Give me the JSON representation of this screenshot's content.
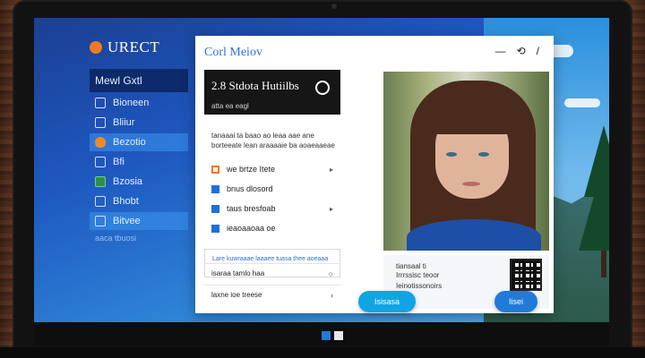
{
  "brand": {
    "name": "URECT",
    "logo_color": "#f07a22"
  },
  "sidebar": {
    "header": "Mewl Gxtl",
    "items": [
      {
        "label": "Bioneen",
        "icon": "globe-icon",
        "active": false
      },
      {
        "label": "Bliiur",
        "icon": "grid-icon",
        "active": false
      },
      {
        "label": "Bezotio",
        "icon": "shield-icon",
        "active": true
      },
      {
        "label": "Bfi",
        "icon": "folder-icon",
        "active": false
      },
      {
        "label": "Bzosia",
        "icon": "green-app-icon",
        "active": false
      },
      {
        "label": "Bhobt",
        "icon": "grid-icon",
        "active": false
      },
      {
        "label": "Bitvee",
        "icon": "window-icon",
        "active": true
      }
    ],
    "footer": "aaca tbuosi"
  },
  "window": {
    "title": "Corl Meiov",
    "controls": [
      "—",
      "⟲",
      "/"
    ],
    "card": {
      "title": "2.8 Stdota Hutiilbs",
      "subtitle": "atta ea eagl"
    },
    "description": "tanaaai ta baao ao leaa aae ane borteeate lean araaaaie ba aoaeaaeae",
    "list": [
      {
        "label": "we brtze Itete",
        "icon": "orange-square-icon"
      },
      {
        "label": "bnus dlosord",
        "icon": "blue-square-icon"
      },
      {
        "label": "taus bresfoab",
        "icon": "blue-square-icon"
      },
      {
        "label": "ieaoaaoaa oe",
        "icon": "blue-square-icon"
      }
    ],
    "hint": "Lare kuwraaae laaaee tuasa thee aoeaaa",
    "actions": [
      {
        "label": "isaraa tamlo haa",
        "glyph": "○"
      },
      {
        "label": "laxne ioe treese",
        "glyph": "›"
      }
    ]
  },
  "profile": {
    "info_lines": [
      "tiansaal ti",
      "Irrrssisc teoor",
      "Ieinotissonoirs"
    ],
    "primary_button": "Isisasa",
    "secondary_button": "Iisei"
  },
  "colors": {
    "accent": "#2b6fd8",
    "primary_button": "#11a4e5",
    "secondary_button": "#1f7bd8"
  }
}
